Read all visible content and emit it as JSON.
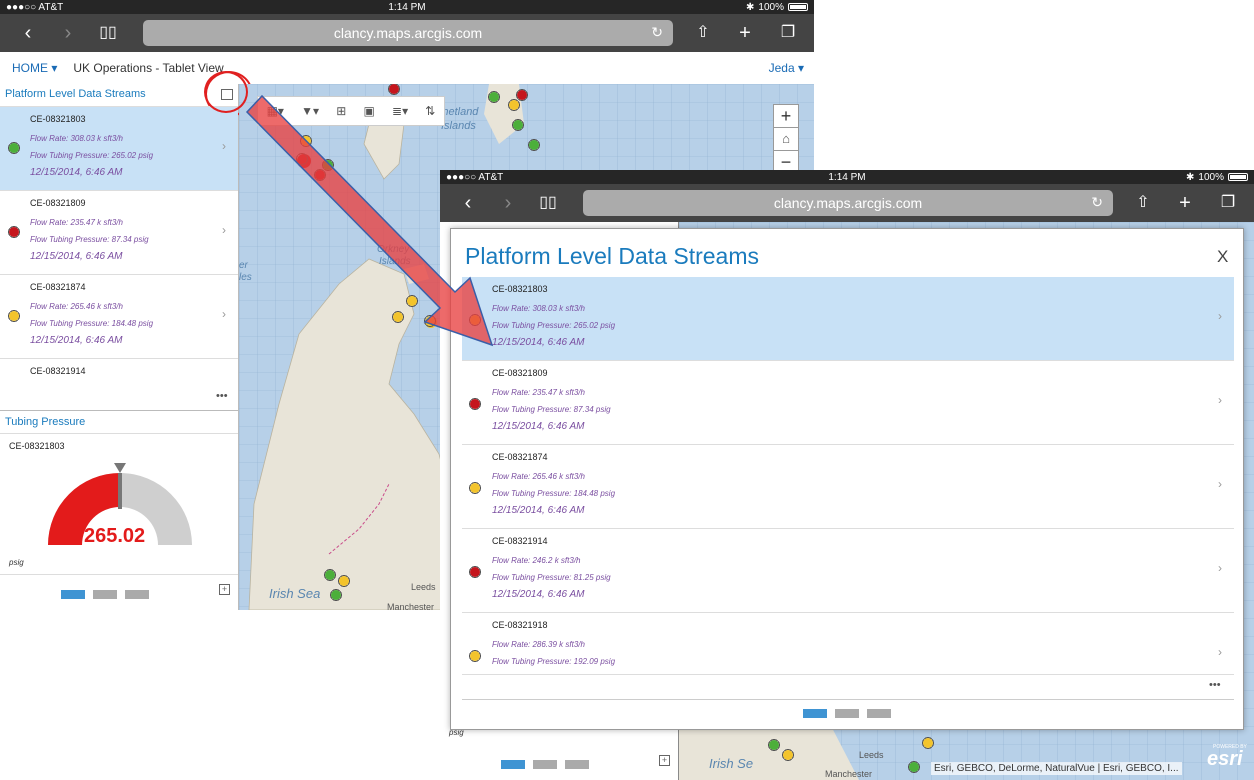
{
  "left": {
    "status": {
      "carrier": "●●●○○ AT&T",
      "time": "1:14 PM",
      "battery": "100%"
    },
    "url": "clancy.maps.arcgis.com",
    "appbar": {
      "home": "HOME ▾",
      "title": "UK Operations - Tablet View",
      "user": "Jeda ▾"
    },
    "list_title": "Platform Level Data Streams",
    "items": [
      {
        "id": "CE-08321803",
        "flow": "Flow Rate: 308.03 k sft3/h",
        "ftp": "Flow Tubing Pressure: 265.02 psig",
        "date": "12/15/2014, 6:46 AM"
      },
      {
        "id": "CE-08321809",
        "flow": "Flow Rate: 235.47 k sft3/h",
        "ftp": "Flow Tubing Pressure: 87.34 psig",
        "date": "12/15/2014, 6:46 AM"
      },
      {
        "id": "CE-08321874",
        "flow": "Flow Rate: 265.46 k sft3/h",
        "ftp": "Flow Tubing Pressure: 184.48 psig",
        "date": "12/15/2014, 6:46 AM"
      },
      {
        "id": "CE-08321914"
      }
    ],
    "more": "•••",
    "gauge": {
      "title": "Tubing Pressure",
      "id": "CE-08321803",
      "value": "265.02",
      "unit": "psig",
      "fraction": 0.5
    },
    "map_labels": {
      "shetland": "Shetland",
      "islands": "Islands",
      "orkney": "Orkney",
      "orkney_islands": "Islands",
      "irish_sea": "Irish Sea",
      "leeds": "Leeds",
      "manchester": "Manchester",
      "sidebar_er": "er",
      "sidebar_les": "les"
    }
  },
  "right": {
    "status": {
      "carrier": "●●●○○ AT&T",
      "time": "1:14 PM",
      "battery": "100%"
    },
    "url": "clancy.maps.arcgis.com",
    "modal_title": "Platform Level Data Streams",
    "close": "X",
    "items": [
      {
        "id": "CE-08321803",
        "flow": "Flow Rate: 308.03 k sft3/h",
        "ftp": "Flow Tubing Pressure: 265.02 psig",
        "date": "12/15/2014, 6:46 AM"
      },
      {
        "id": "CE-08321809",
        "flow": "Flow Rate: 235.47 k sft3/h",
        "ftp": "Flow Tubing Pressure: 87.34 psig",
        "date": "12/15/2014, 6:46 AM"
      },
      {
        "id": "CE-08321874",
        "flow": "Flow Rate: 265.46 k sft3/h",
        "ftp": "Flow Tubing Pressure: 184.48 psig",
        "date": "12/15/2014, 6:46 AM"
      },
      {
        "id": "CE-08321914",
        "flow": "Flow Rate: 246.2 k sft3/h",
        "ftp": "Flow Tubing Pressure: 81.25 psig",
        "date": "12/15/2014, 6:46 AM"
      },
      {
        "id": "CE-08321918",
        "flow": "Flow Rate: 286.39 k sft3/h",
        "ftp": "Flow Tubing Pressure: 192.09 psig"
      }
    ],
    "more": "•••",
    "psig_behind": "psig",
    "attribution": "Esri, GEBCO, DeLorme, NaturalVue | Esri, GEBCO, I...",
    "esri": "esri",
    "powered": "POWERED BY",
    "map_labels": {
      "irish_sea": "Irish Se",
      "leeds": "Leeds",
      "manchester": "Manchester"
    }
  },
  "colors": {
    "accent": "#1a7bbd",
    "selected": "#c8e1f6",
    "red": "#c5161d",
    "green": "#4caf3a",
    "yellow": "#f3c42c"
  }
}
